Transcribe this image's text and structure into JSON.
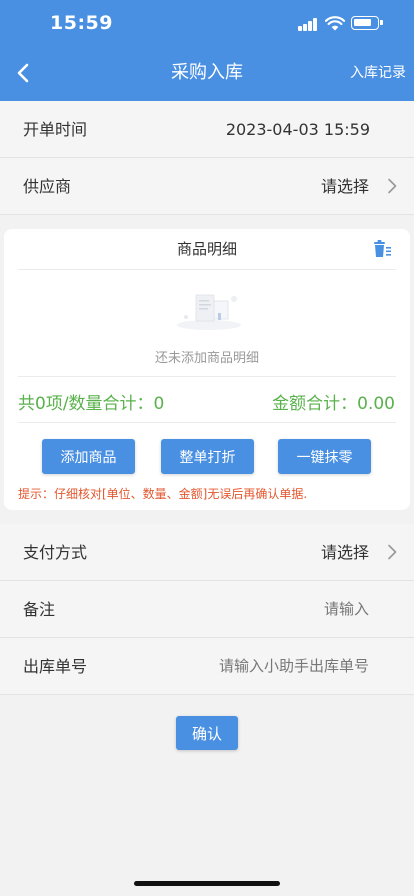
{
  "status_bar": {
    "time": "15:59"
  },
  "nav": {
    "title": "采购入库",
    "right_link": "入库记录"
  },
  "fields": {
    "order_time": {
      "label": "开单时间",
      "value": "2023-04-03 15:59"
    },
    "supplier": {
      "label": "供应商",
      "value": "请选择"
    },
    "payment": {
      "label": "支付方式",
      "value": "请选择"
    },
    "remark": {
      "label": "备注",
      "placeholder": "请输入"
    },
    "outbound_no": {
      "label": "出库单号",
      "placeholder": "请输入小助手出库单号"
    }
  },
  "goods": {
    "title": "商品明细",
    "empty_text": "还未添加商品明细",
    "summary_left": "共0项/数量合计：0",
    "summary_right": "金额合计：0.00",
    "buttons": {
      "add": "添加商品",
      "discount": "整单打折",
      "round": "一键抹零"
    },
    "tip": "提示：仔细核对[单位、数量、金额]无误后再确认单据."
  },
  "confirm_label": "确认",
  "colors": {
    "primary": "#4a90e2",
    "success": "#59b24b",
    "warning": "#e4572e"
  }
}
